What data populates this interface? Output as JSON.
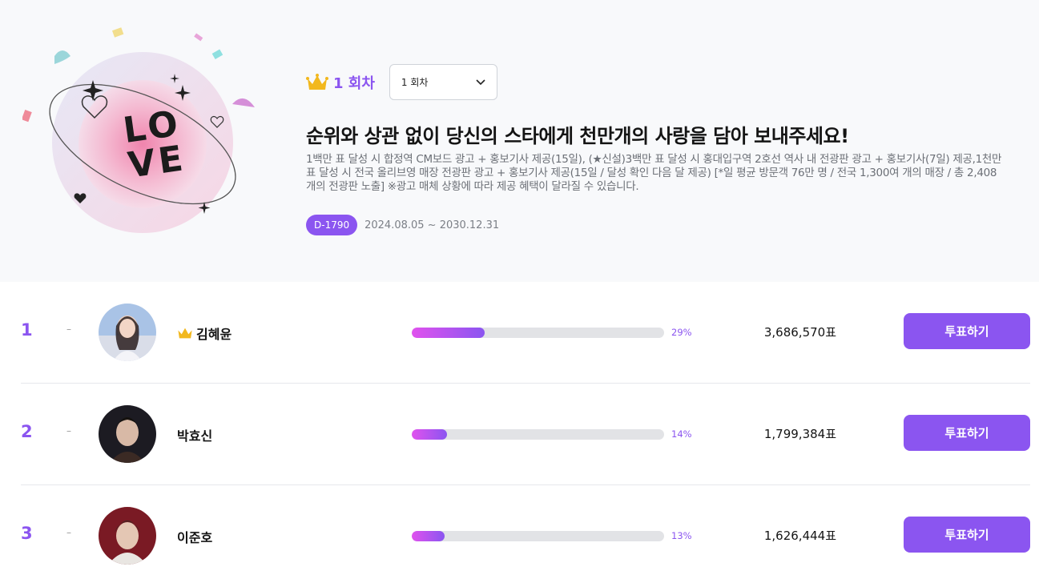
{
  "header": {
    "round_label": "1 회차",
    "round_select_value": "1 회차",
    "headline": "순위와 상관 없이 당신의 스타에게 천만개의 사랑을 담아 보내주세요!",
    "description": "1백만 표 달성 시 합정역 CM보드 광고 + 홍보기사 제공(15일), (★신설)3백만 표 달성 시 홍대입구역 2호선 역사 내 전광판 광고 + 홍보기사(7일) 제공,1천만 표 달성 시 전국 올리브영 매장 전광판 광고 + 홍보기사 제공(15일 / 달성 확인 다음 달 제공) [*일 평균 방문객 76만 명 / 전국 1,300여 개의 매장 / 총 2,408개의 전광판 노출] ※광고 매체 상황에 따라 제공 혜택이 달라질 수 있습니다.",
    "dday": "D-1790",
    "period": "2024.08.05 ~ 2030.12.31",
    "art_text": "LOVE"
  },
  "ranking": [
    {
      "rank": "1",
      "change": "–",
      "name": "김혜윤",
      "crown": true,
      "percent_label": "29%",
      "percent": 29,
      "votes": "3,686,570표",
      "button": "투표하기"
    },
    {
      "rank": "2",
      "change": "–",
      "name": "박효신",
      "crown": false,
      "percent_label": "14%",
      "percent": 14,
      "votes": "1,799,384표",
      "button": "투표하기"
    },
    {
      "rank": "3",
      "change": "–",
      "name": "이준호",
      "crown": false,
      "percent_label": "13%",
      "percent": 13,
      "votes": "1,626,444표",
      "button": "투표하기"
    }
  ],
  "colors": {
    "accent": "#8b55f0",
    "bar_start": "#e052ee",
    "hero_bg": "#f8f9fb"
  }
}
